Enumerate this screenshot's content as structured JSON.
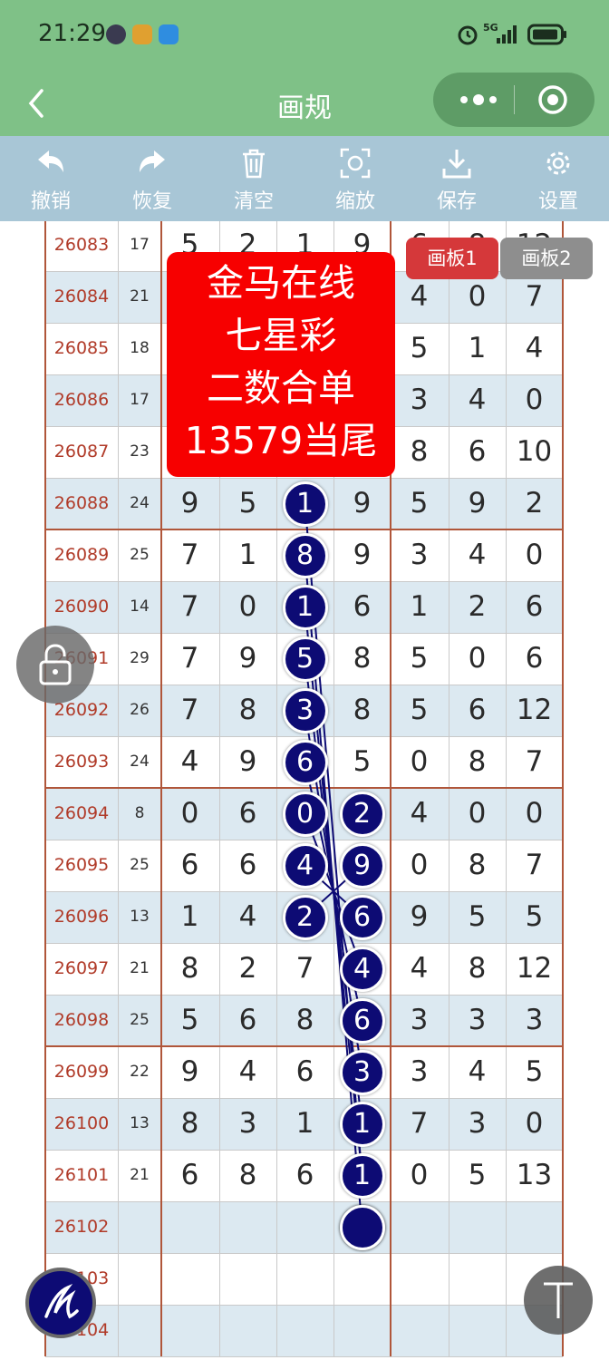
{
  "status_bar": {
    "time": "21:29",
    "network": "5G"
  },
  "nav": {
    "title": "画规"
  },
  "toolbar": {
    "items": [
      {
        "label": "撤销",
        "icon": "undo-icon"
      },
      {
        "label": "恢复",
        "icon": "redo-icon"
      },
      {
        "label": "清空",
        "icon": "trash-icon"
      },
      {
        "label": "缩放",
        "icon": "zoom-icon"
      },
      {
        "label": "保存",
        "icon": "download-icon"
      },
      {
        "label": "设置",
        "icon": "gear-icon"
      }
    ]
  },
  "tabs": {
    "board1": "画板1",
    "board2": "画板2"
  },
  "promo": {
    "lines": [
      "金马在线",
      "七星彩",
      "二数合单",
      "13579当尾"
    ]
  },
  "table": {
    "rows": [
      {
        "issue": "26083",
        "sum": "17",
        "d": [
          "5",
          "2",
          "1",
          "9",
          "6",
          "8",
          "12"
        ]
      },
      {
        "issue": "26084",
        "sum": "21",
        "d": [
          "",
          "",
          "",
          "",
          "4",
          "0",
          "7"
        ]
      },
      {
        "issue": "26085",
        "sum": "18",
        "d": [
          "",
          "",
          "",
          "",
          "5",
          "1",
          "4"
        ]
      },
      {
        "issue": "26086",
        "sum": "17",
        "d": [
          "",
          "",
          "",
          "",
          "3",
          "4",
          "0"
        ]
      },
      {
        "issue": "26087",
        "sum": "23",
        "d": [
          "",
          "",
          "",
          "",
          "8",
          "6",
          "10"
        ]
      },
      {
        "issue": "26088",
        "sum": "24",
        "d": [
          "9",
          "5",
          "1",
          "9",
          "5",
          "9",
          "2"
        ]
      },
      {
        "issue": "26089",
        "sum": "25",
        "d": [
          "7",
          "1",
          "8",
          "9",
          "3",
          "4",
          "0"
        ]
      },
      {
        "issue": "26090",
        "sum": "14",
        "d": [
          "7",
          "0",
          "1",
          "6",
          "1",
          "2",
          "6"
        ]
      },
      {
        "issue": "26091",
        "sum": "29",
        "d": [
          "7",
          "9",
          "5",
          "8",
          "5",
          "0",
          "6"
        ]
      },
      {
        "issue": "26092",
        "sum": "26",
        "d": [
          "7",
          "8",
          "3",
          "8",
          "5",
          "6",
          "12"
        ]
      },
      {
        "issue": "26093",
        "sum": "24",
        "d": [
          "4",
          "9",
          "6",
          "5",
          "0",
          "8",
          "7"
        ]
      },
      {
        "issue": "26094",
        "sum": "8",
        "d": [
          "0",
          "6",
          "0",
          "2",
          "4",
          "0",
          "0"
        ]
      },
      {
        "issue": "26095",
        "sum": "25",
        "d": [
          "6",
          "6",
          "4",
          "9",
          "0",
          "8",
          "7"
        ]
      },
      {
        "issue": "26096",
        "sum": "13",
        "d": [
          "1",
          "4",
          "2",
          "6",
          "9",
          "5",
          "5"
        ]
      },
      {
        "issue": "26097",
        "sum": "21",
        "d": [
          "8",
          "2",
          "7",
          "4",
          "4",
          "8",
          "12"
        ]
      },
      {
        "issue": "26098",
        "sum": "25",
        "d": [
          "5",
          "6",
          "8",
          "6",
          "3",
          "3",
          "3"
        ]
      },
      {
        "issue": "26099",
        "sum": "22",
        "d": [
          "9",
          "4",
          "6",
          "3",
          "3",
          "4",
          "5"
        ]
      },
      {
        "issue": "26100",
        "sum": "13",
        "d": [
          "8",
          "3",
          "1",
          "1",
          "7",
          "3",
          "0"
        ]
      },
      {
        "issue": "26101",
        "sum": "21",
        "d": [
          "6",
          "8",
          "6",
          "1",
          "0",
          "5",
          "13"
        ]
      },
      {
        "issue": "26102",
        "sum": "",
        "d": [
          "",
          "",
          "",
          "",
          "",
          "",
          ""
        ]
      },
      {
        "issue": "26103",
        "sum": "",
        "d": [
          "",
          "",
          "",
          "",
          "",
          "",
          ""
        ]
      },
      {
        "issue": "26104",
        "sum": "",
        "d": [
          "",
          "",
          "",
          "",
          "",
          "",
          ""
        ]
      }
    ],
    "marked": [
      {
        "row": 5,
        "col": 2
      },
      {
        "row": 6,
        "col": 2
      },
      {
        "row": 7,
        "col": 2
      },
      {
        "row": 8,
        "col": 2
      },
      {
        "row": 9,
        "col": 2
      },
      {
        "row": 10,
        "col": 2
      },
      {
        "row": 11,
        "col": 2
      },
      {
        "row": 12,
        "col": 2
      },
      {
        "row": 13,
        "col": 2
      },
      {
        "row": 11,
        "col": 3
      },
      {
        "row": 12,
        "col": 3
      },
      {
        "row": 13,
        "col": 3
      },
      {
        "row": 14,
        "col": 3
      },
      {
        "row": 15,
        "col": 3
      },
      {
        "row": 16,
        "col": 3
      },
      {
        "row": 17,
        "col": 3
      },
      {
        "row": 18,
        "col": 3
      },
      {
        "row": 19,
        "col": 3
      }
    ],
    "lines": [
      [
        5,
        2,
        18,
        3
      ],
      [
        6,
        2,
        19,
        3
      ],
      [
        7,
        2,
        18,
        3
      ],
      [
        8,
        2,
        17,
        3
      ],
      [
        9,
        2,
        16,
        3
      ],
      [
        10,
        2,
        15,
        3
      ],
      [
        11,
        2,
        14,
        3
      ],
      [
        12,
        2,
        13,
        3
      ],
      [
        13,
        2,
        12,
        3
      ]
    ]
  },
  "colors": {
    "header": "#7fc187",
    "toolbar": "#a8c6d6",
    "ball": "#0d0b74",
    "promo": "#f70000",
    "grid": "#b0563a",
    "stripe": "#dce9f1"
  }
}
